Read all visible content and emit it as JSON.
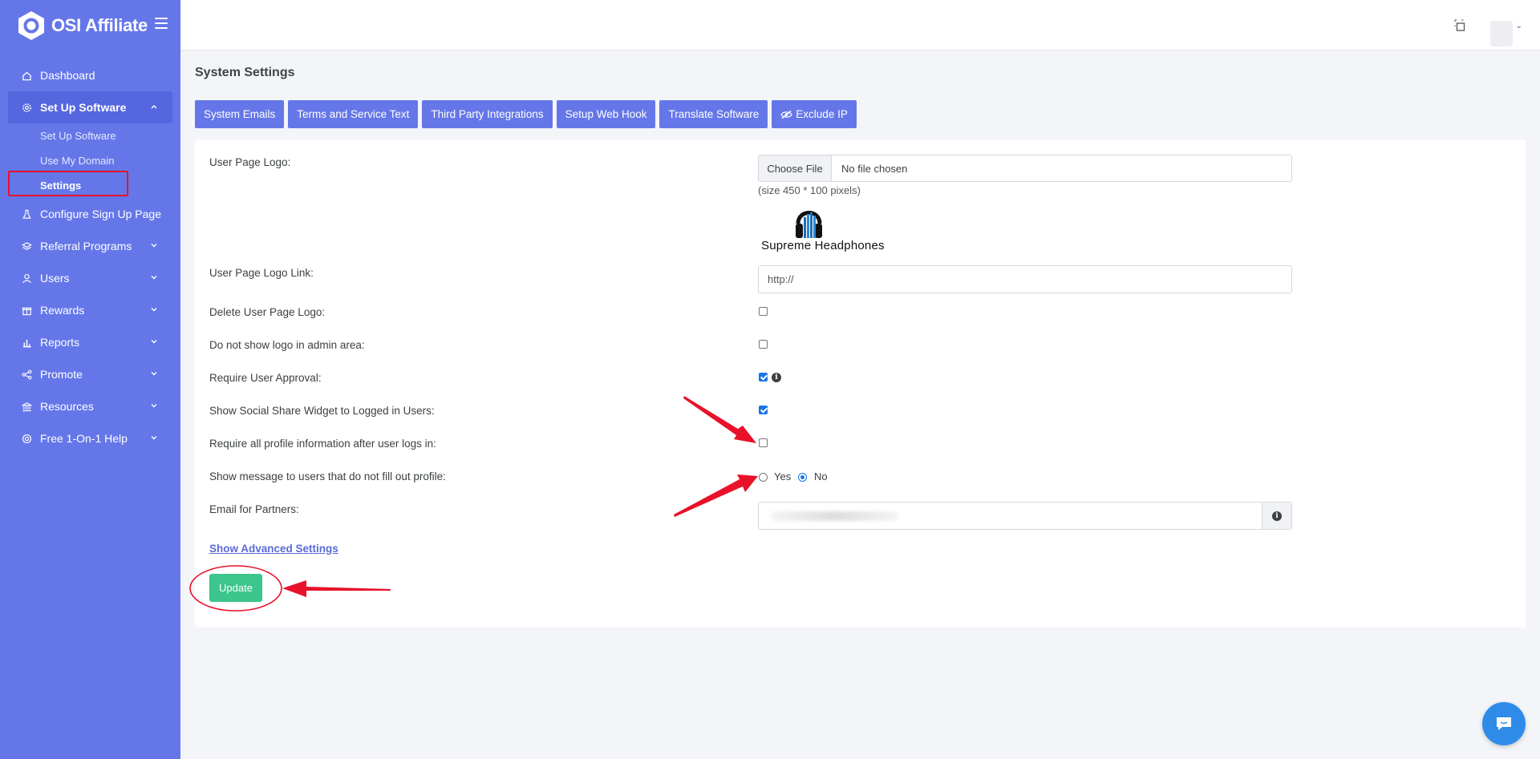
{
  "app": {
    "brand": "OSI Affiliate"
  },
  "sidebar": {
    "items": [
      {
        "label": "Dashboard",
        "icon": "home-icon"
      },
      {
        "label": "Set Up Software",
        "icon": "gear-icon",
        "expanded": true,
        "children": [
          "Set Up Software",
          "Use My Domain",
          "Settings"
        ]
      },
      {
        "label": "Configure Sign Up Page",
        "icon": "flask-icon"
      },
      {
        "label": "Referral Programs",
        "icon": "layers-icon"
      },
      {
        "label": "Users",
        "icon": "user-icon"
      },
      {
        "label": "Rewards",
        "icon": "gift-icon"
      },
      {
        "label": "Reports",
        "icon": "bar-chart-icon"
      },
      {
        "label": "Promote",
        "icon": "share-icon"
      },
      {
        "label": "Resources",
        "icon": "bank-icon"
      },
      {
        "label": "Free 1-On-1 Help",
        "icon": "lifebuoy-icon"
      }
    ]
  },
  "page": {
    "title": "System Settings"
  },
  "tabs": [
    "System Emails",
    "Terms and Service Text",
    "Third Party Integrations",
    "Setup Web Hook",
    "Translate Software",
    "Exclude IP"
  ],
  "form": {
    "logo_label": "User Page Logo:",
    "file_button": "Choose File",
    "file_status": "No file chosen",
    "size_hint": "(size 450 * 100 pixels)",
    "logo_caption": "Supreme Headphones",
    "logo_link_label": "User Page Logo Link:",
    "logo_link_value": "http://",
    "delete_logo_label": "Delete User Page Logo:",
    "delete_logo_checked": false,
    "hide_logo_admin_label": "Do not show logo in admin area:",
    "hide_logo_admin_checked": false,
    "require_approval_label": "Require User Approval:",
    "require_approval_checked": true,
    "social_widget_label": "Show Social Share Widget to Logged in Users:",
    "social_widget_checked": true,
    "require_profile_label": "Require all profile information after user logs in:",
    "require_profile_checked": false,
    "show_message_label": "Show message to users that do not fill out profile:",
    "radio_yes": "Yes",
    "radio_no": "No",
    "radio_selected": "No",
    "email_label": "Email for Partners:",
    "advanced_link": "Show Advanced Settings",
    "update_button": "Update"
  },
  "colors": {
    "sidebar": "#6577e8",
    "tab": "#6577e8",
    "update": "#3cc58d",
    "annotation": "#e8122a",
    "chat": "#2e8ce8"
  }
}
